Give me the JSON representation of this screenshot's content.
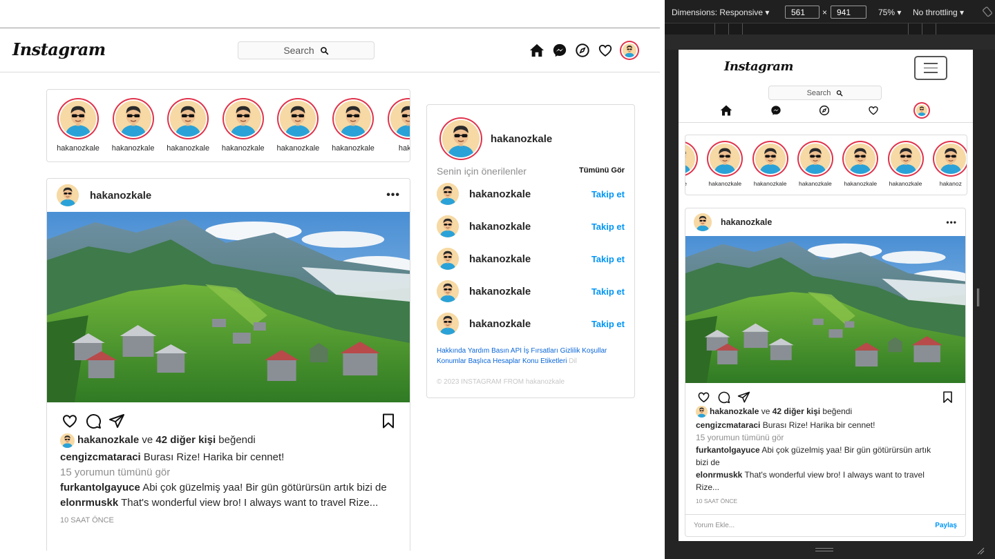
{
  "desktop": {
    "logo": "Instagram",
    "search_placeholder": "Search",
    "stories": [
      "hakanozkale",
      "hakanozkale",
      "hakanozkale",
      "hakanozkale",
      "hakanozkale",
      "hakanozkale",
      "hakar"
    ],
    "post": {
      "user": "hakanozkale",
      "more": "•••",
      "likes_user": "hakanozkale",
      "likes_mid": " ve ",
      "likes_count": "42 diğer kişi",
      "likes_tail": " beğendi",
      "comments": [
        {
          "user": "cengizcmataraci",
          "text": " Burası Rize! Harika bir cennet!"
        },
        {
          "user": "furkantolgayuce",
          "text": "  Abi çok güzelmiş yaa! Bir gün götürürsün artık bizi de"
        },
        {
          "user": "elonrmuskk",
          "text": " That's wonderful view bro! I always want to travel Rize..."
        }
      ],
      "view_all": "15 yorumun tümünü gör",
      "time": "10 SAAT ÖNCE"
    },
    "sidebar": {
      "user": "hakanozkale",
      "title": "Senin için önerilenler",
      "see_all": "Tümünü Gör",
      "suggestions": [
        {
          "user": "hakanozkale",
          "action": "Takip et"
        },
        {
          "user": "hakanozkale",
          "action": "Takip et"
        },
        {
          "user": "hakanozkale",
          "action": "Takip et"
        },
        {
          "user": "hakanozkale",
          "action": "Takip et"
        },
        {
          "user": "hakanozkale",
          "action": "Takip et"
        }
      ],
      "links": "Hakkında Yardım Basın API İş Fırsatları Gizlilik Koşullar Konumlar Başlıca Hesaplar Konu Etiketleri",
      "links_muted": "Dil",
      "copyright": "© 2023 INSTAGRAM FROM hakanozkale"
    }
  },
  "devtools": {
    "dimensions_label": "Dimensions: Responsive ▾",
    "width": "561",
    "times": "×",
    "height": "941",
    "zoom": "75% ▾",
    "throttling": "No throttling ▾"
  },
  "mobile": {
    "logo": "Instagram",
    "search_placeholder": "Search",
    "stories": [
      "zkale",
      "hakanozkale",
      "hakanozkale",
      "hakanozkale",
      "hakanozkale",
      "hakanozkale",
      "hakanoz"
    ],
    "post": {
      "user": "hakanozkale",
      "more": "•••",
      "likes_user": "hakanozkale",
      "likes_mid": " ve ",
      "likes_count": "42 diğer kişi",
      "likes_tail": " beğendi",
      "c1_user": "cengizcmataraci",
      "c1_text": " Burası Rize! Harika bir cennet!",
      "view_all": "15 yorumun tümünü gör",
      "c2_user": "furkantolgayuce",
      "c2_text_a": "  Abi çok güzelmiş yaa! Bir gün götürürsün artık",
      "c2_text_b": " bizi de",
      "c3_user": "elonrmuskk",
      "c3_text_a": " That's wonderful view bro! I always want to travel",
      "c3_text_b": " Rize...",
      "time": "10 SAAT ÖNCE",
      "add_comment_placeholder": "Yorum Ekle...",
      "share": "Paylaş"
    }
  },
  "colors": {
    "link_blue": "#0095f6",
    "story_ring": "#e0324b",
    "border": "#dbdbdb"
  }
}
